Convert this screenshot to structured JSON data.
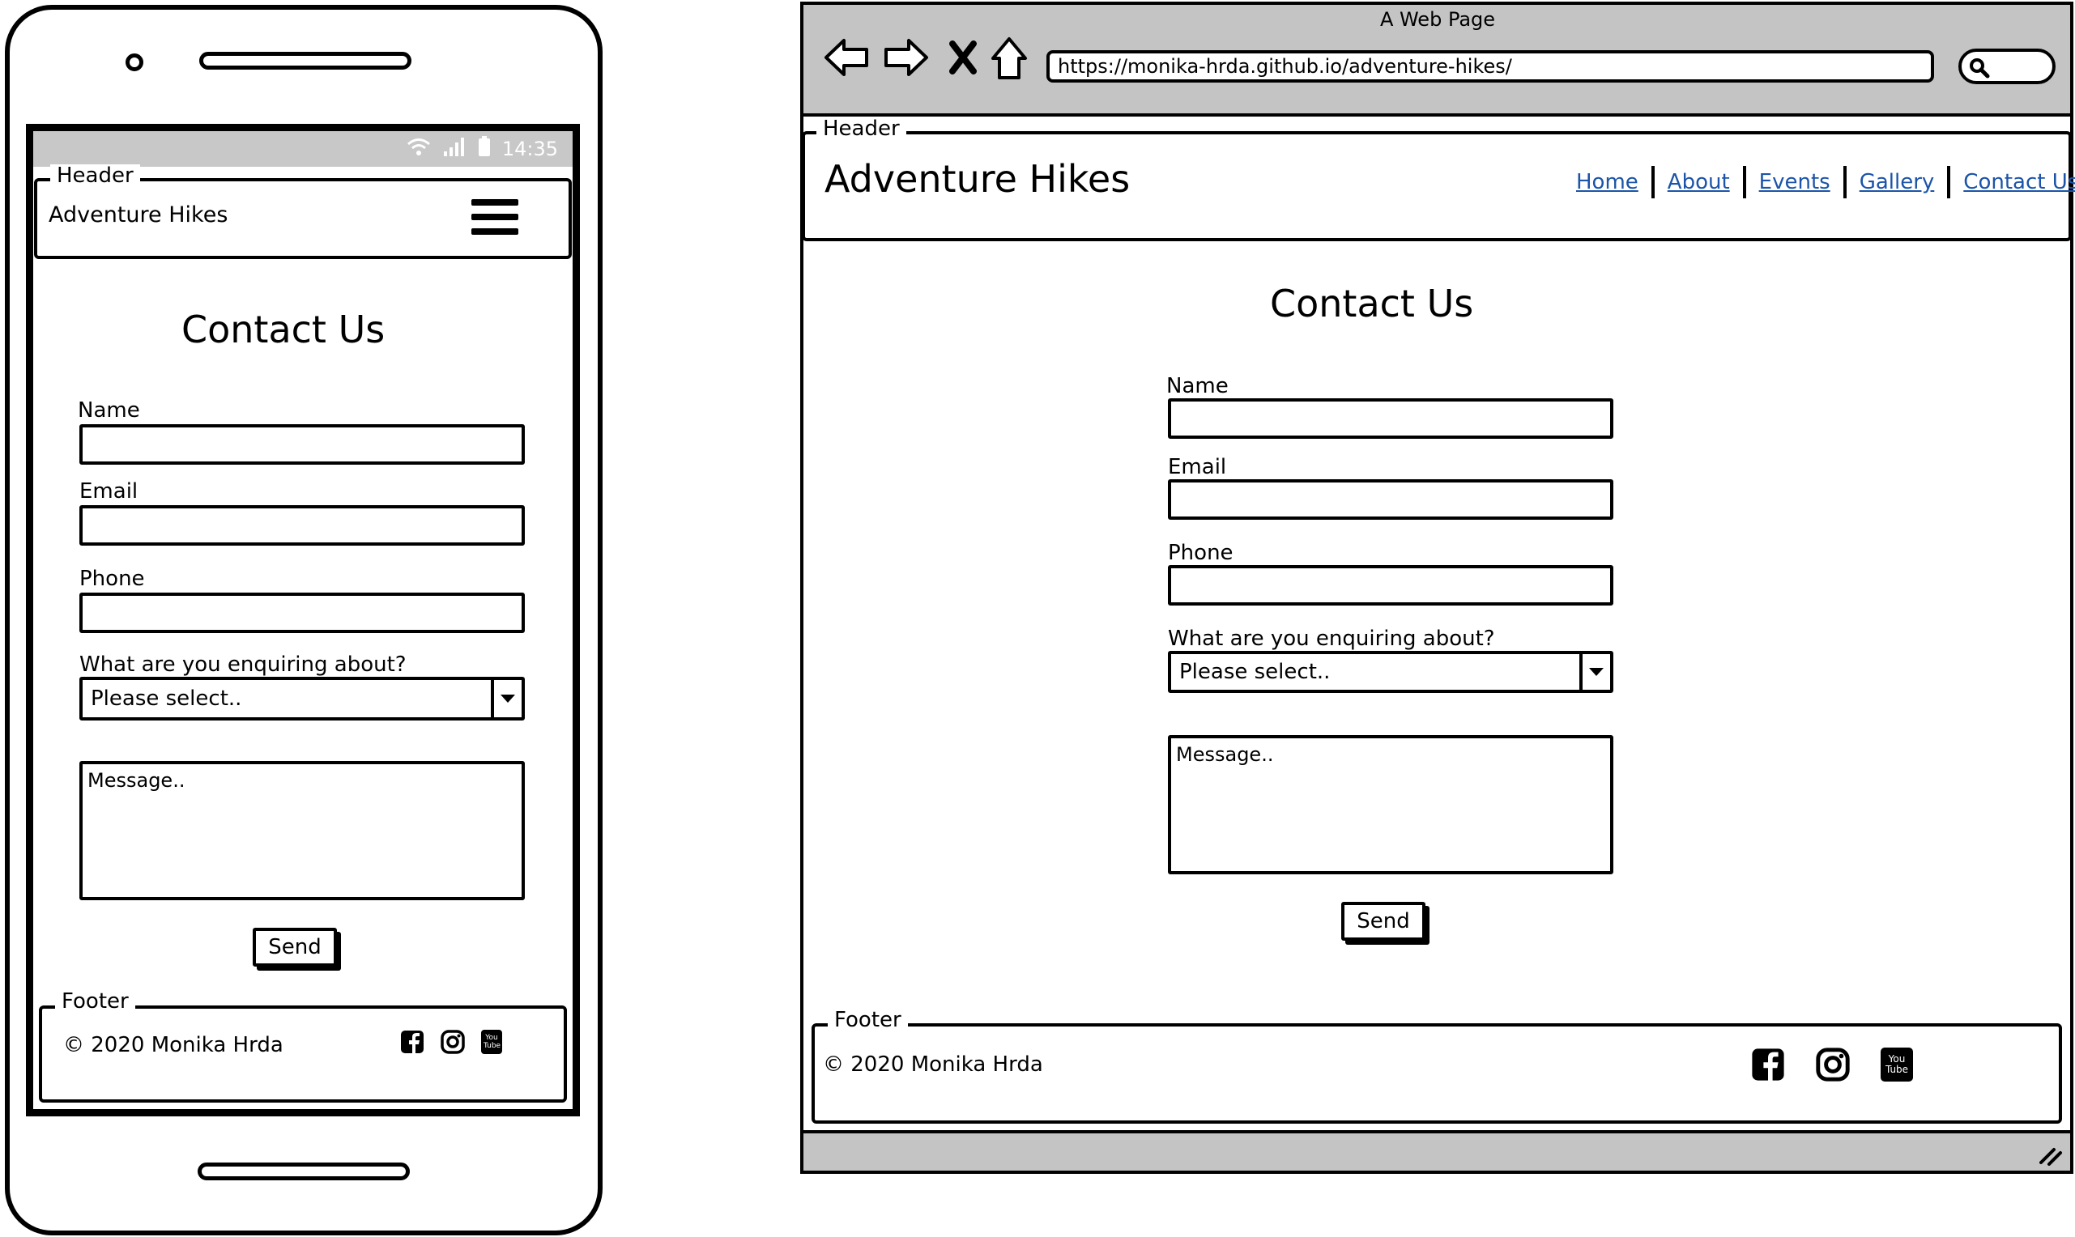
{
  "mobile": {
    "status_time": "14:35",
    "header_label": "Header",
    "brand": "Adventure Hikes",
    "heading": "Contact Us",
    "form": {
      "name_label": "Name",
      "email_label": "Email",
      "phone_label": "Phone",
      "enquiry_label": "What are you enquiring about?",
      "select_value": "Please select..",
      "message_placeholder": "Message..",
      "send_label": "Send"
    },
    "footer_label": "Footer",
    "copyright": "© 2020 Monika Hrda",
    "youtube_text": "You Tube"
  },
  "desktop": {
    "window_title": "A Web Page",
    "url": "https://monika-hrda.github.io/adventure-hikes/",
    "header_label": "Header",
    "brand": "Adventure Hikes",
    "nav": {
      "home": "Home",
      "about": "About",
      "events": "Events",
      "gallery": "Gallery",
      "contact": "Contact Us"
    },
    "heading": "Contact Us",
    "form": {
      "name_label": "Name",
      "email_label": "Email",
      "phone_label": "Phone",
      "enquiry_label": "What are you enquiring about?",
      "select_value": "Please select..",
      "message_placeholder": "Message..",
      "send_label": "Send"
    },
    "footer_label": "Footer",
    "copyright": "© 2020 Monika Hrda",
    "youtube_text": "You Tube"
  },
  "colors": {
    "link": "#1b54a8",
    "chrome_gray": "#c4c4c4",
    "statusbar_gray": "#c8c8c8"
  },
  "icons": [
    "wifi-icon",
    "signal-icon",
    "battery-icon",
    "hamburger-menu-icon",
    "facebook-icon",
    "instagram-icon",
    "youtube-icon",
    "back-arrow-icon",
    "forward-arrow-icon",
    "stop-icon",
    "home-icon",
    "search-icon",
    "resize-grip-icon"
  ]
}
